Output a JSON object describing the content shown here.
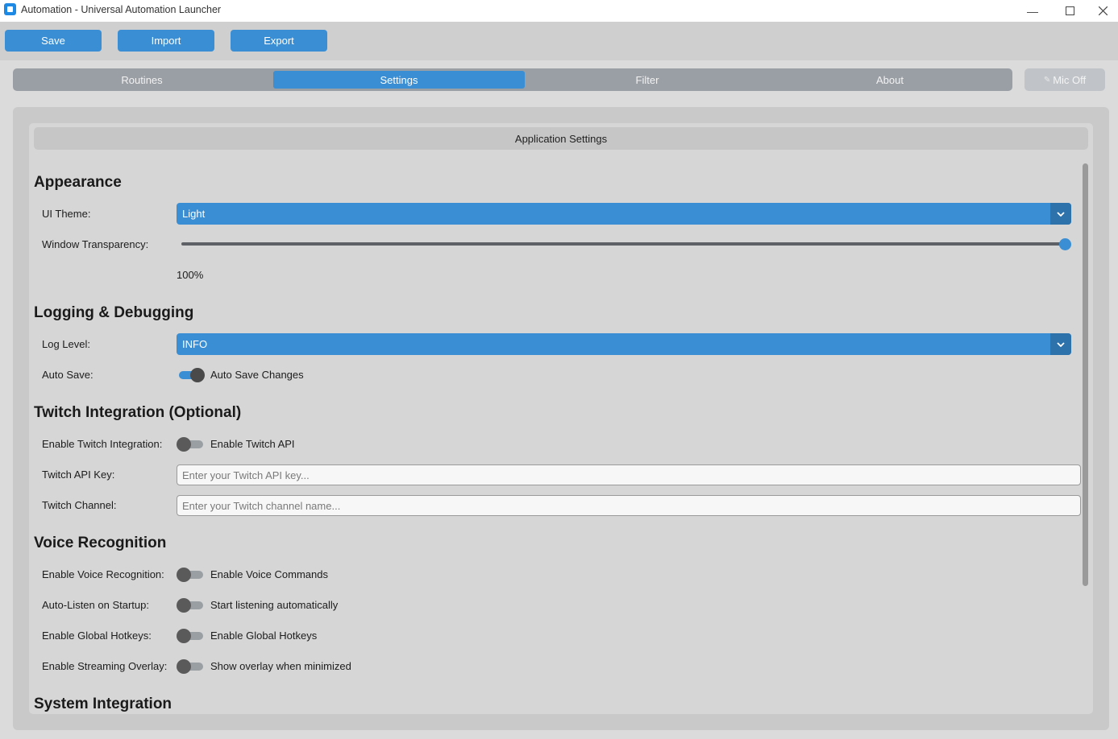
{
  "window": {
    "title": "Automation - Universal Automation Launcher"
  },
  "toolbar": {
    "save_label": "Save",
    "import_label": "Import",
    "export_label": "Export"
  },
  "tabs": [
    {
      "label": "Routines",
      "active": false
    },
    {
      "label": "Settings",
      "active": true
    },
    {
      "label": "Filter",
      "active": false
    },
    {
      "label": "About",
      "active": false
    }
  ],
  "mic_button": {
    "label": "Mic Off",
    "icon": "pencil-icon"
  },
  "settings": {
    "header": "Application Settings",
    "appearance": {
      "title": "Appearance",
      "ui_theme_label": "UI Theme:",
      "ui_theme_value": "Light",
      "transparency_label": "Window Transparency:",
      "transparency_value": "100%",
      "transparency_fraction": 1.0
    },
    "logging": {
      "title": "Logging & Debugging",
      "log_level_label": "Log Level:",
      "log_level_value": "INFO",
      "auto_save_label": "Auto Save:",
      "auto_save_switch_label": "Auto Save Changes",
      "auto_save_on": true
    },
    "twitch": {
      "title": "Twitch Integration (Optional)",
      "enable_label": "Enable Twitch Integration:",
      "enable_switch_label": "Enable Twitch API",
      "enable_on": false,
      "api_key_label": "Twitch API Key:",
      "api_key_value": "",
      "api_key_placeholder": "Enter your Twitch API key...",
      "channel_label": "Twitch Channel:",
      "channel_value": "",
      "channel_placeholder": "Enter your Twitch channel name..."
    },
    "voice": {
      "title": "Voice Recognition",
      "enable_label": "Enable Voice Recognition:",
      "enable_switch_label": "Enable Voice Commands",
      "enable_on": false,
      "auto_listen_label": "Auto-Listen on Startup:",
      "auto_listen_switch_label": "Start listening automatically",
      "auto_listen_on": false,
      "hotkeys_label": "Enable Global Hotkeys:",
      "hotkeys_switch_label": "Enable Global Hotkeys",
      "hotkeys_on": false,
      "overlay_label": "Enable Streaming Overlay:",
      "overlay_switch_label": "Show overlay when minimized",
      "overlay_on": false
    },
    "system": {
      "title": "System Integration"
    }
  },
  "colors": {
    "accent": "#3a8ed4",
    "accent_dark": "#2d72ab",
    "tab_bar": "#9a9fa5"
  }
}
